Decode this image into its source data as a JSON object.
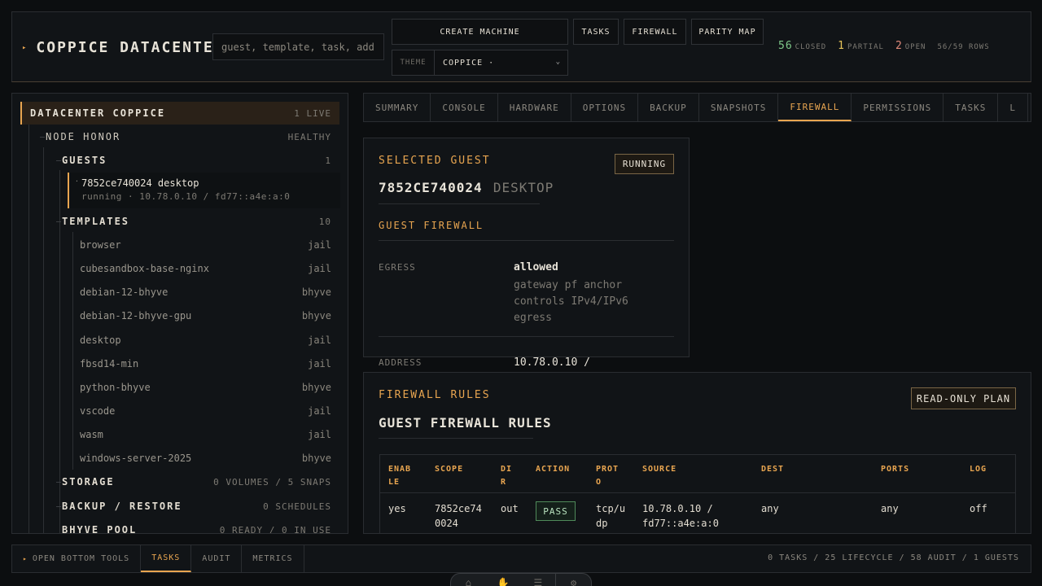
{
  "header": {
    "title": "COPPICE DATACENTER",
    "search_placeholder": "guest, template, task, address",
    "create_label": "CREATE MACHINE",
    "tasks_label": "TASKS",
    "firewall_label": "FIREWALL",
    "parity_label": "PARITY MAP",
    "theme_label": "THEME",
    "theme_value": "COPPICE ·",
    "stats": {
      "closed_n": "56",
      "closed_l": "CLOSED",
      "partial_n": "1",
      "partial_l": "PARTIAL",
      "open_n": "2",
      "open_l": "OPEN",
      "rows": "56/59 ROWS"
    },
    "colors": {
      "closed": "#7fc98a",
      "partial": "#e6c35a",
      "open": "#e08a7a"
    }
  },
  "tree": {
    "datacenter": {
      "label": "DATACENTER COPPICE",
      "status": "1 LIVE"
    },
    "node": {
      "label": "NODE HONOR",
      "status": "HEALTHY"
    },
    "guests": {
      "label": "GUESTS",
      "count": "1"
    },
    "guest": {
      "name": "7852ce740024 desktop",
      "detail": "running · 10.78.0.10 / fd77::a4e:a:0"
    },
    "templates": {
      "label": "TEMPLATES",
      "count": "10"
    },
    "template_items": [
      {
        "name": "browser",
        "type": "jail"
      },
      {
        "name": "cubesandbox-base-nginx",
        "type": "jail"
      },
      {
        "name": "debian-12-bhyve",
        "type": "bhyve"
      },
      {
        "name": "debian-12-bhyve-gpu",
        "type": "bhyve"
      },
      {
        "name": "desktop",
        "type": "jail"
      },
      {
        "name": "fbsd14-min",
        "type": "jail"
      },
      {
        "name": "python-bhyve",
        "type": "bhyve"
      },
      {
        "name": "vscode",
        "type": "jail"
      },
      {
        "name": "wasm",
        "type": "jail"
      },
      {
        "name": "windows-server-2025",
        "type": "bhyve"
      }
    ],
    "storage": {
      "label": "STORAGE",
      "status": "0 VOLUMES / 5 SNAPS"
    },
    "backup": {
      "label": "BACKUP / RESTORE",
      "status": "0 SCHEDULES"
    },
    "pool": {
      "label": "BHYVE POOL",
      "status": "0 READY / 0 IN USE"
    }
  },
  "tabs": [
    "SUMMARY",
    "CONSOLE",
    "HARDWARE",
    "OPTIONS",
    "BACKUP",
    "SNAPSHOTS",
    "FIREWALL",
    "PERMISSIONS",
    "TASKS",
    "L"
  ],
  "selected": {
    "heading": "SELECTED GUEST",
    "badge": "RUNNING",
    "id": "7852CE740024",
    "kind": "DESKTOP",
    "fw_heading": "GUEST FIREWALL",
    "egress_label": "EGRESS",
    "egress_value": "allowed",
    "egress_note": "gateway pf anchor controls IPv4/IPv6 egress",
    "address_label": "ADDRESS",
    "address_value": "10.78.0.10 /"
  },
  "rules": {
    "heading": "FIREWALL RULES",
    "badge": "READ-ONLY PLAN",
    "title": "GUEST FIREWALL RULES",
    "columns": [
      "ENAB LE",
      "SCOPE",
      "DI R",
      "ACTION",
      "PROT O",
      "SOURCE",
      "DEST",
      "PORTS",
      "LOG"
    ],
    "row": {
      "enable": "yes",
      "scope": "7852ce74 0024",
      "dir": "out",
      "action": "PASS",
      "proto": "tcp/u dp",
      "source": "10.78.0.10 / fd77::a4e:a:0",
      "dest": "any",
      "ports": "any",
      "log": "off"
    }
  },
  "bottom": {
    "open_tools": "OPEN BOTTOM TOOLS",
    "tabs": [
      "TASKS",
      "AUDIT",
      "METRICS"
    ],
    "summary": "0 TASKS / 25 LIFECYCLE / 58 AUDIT / 1 GUESTS"
  }
}
